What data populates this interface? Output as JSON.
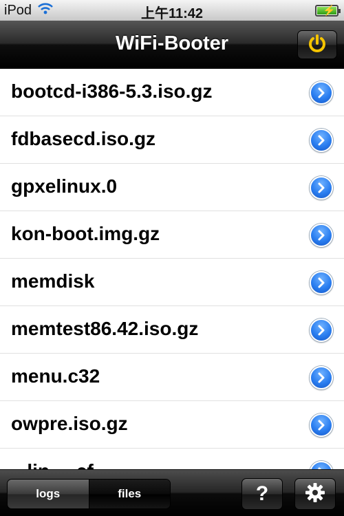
{
  "status_bar": {
    "carrier": "iPod",
    "time": "上午11:42"
  },
  "nav": {
    "title": "WiFi-Booter"
  },
  "files": [
    "bootcd-i386-5.3.iso.gz",
    "fdbasecd.iso.gz",
    "gpxelinux.0",
    "kon-boot.img.gz",
    "memdisk",
    "memtest86.42.iso.gz",
    "menu.c32",
    "owpre.iso.gz",
    "...lin... .cf..."
  ],
  "toolbar": {
    "segments": [
      {
        "label": "logs",
        "selected": false
      },
      {
        "label": "files",
        "selected": true
      }
    ],
    "help_label": "?"
  },
  "icons": {
    "wifi": "wifi-icon",
    "battery": "battery-charging-icon",
    "power": "power-icon",
    "disclosure": "chevron-right-circle-icon",
    "settings": "gear-icon"
  },
  "colors": {
    "power_accent": "#f5c400",
    "disclosure_blue": "#2a7ef0"
  }
}
